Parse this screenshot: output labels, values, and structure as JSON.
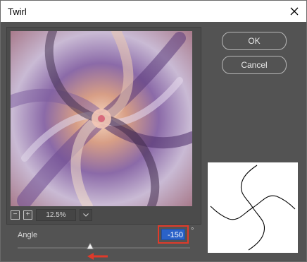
{
  "window": {
    "title": "Twirl"
  },
  "zoom": {
    "value": "12.5%",
    "minus_label": "−",
    "plus_label": "+"
  },
  "buttons": {
    "ok_label": "OK",
    "cancel_label": "Cancel"
  },
  "angle": {
    "label": "Angle",
    "value": "-150",
    "unit": "°"
  },
  "slider": {
    "value": -150,
    "min": -999,
    "max": 999
  },
  "colors": {
    "dialog_bg": "#535353",
    "highlight_box": "#e03a2a",
    "selection": "#2a62c9",
    "annotation_arrow": "#e03a2a"
  },
  "icons": {
    "close": "close-icon",
    "dropdown": "chevron-down-icon",
    "annotation": "left-arrow-icon"
  }
}
